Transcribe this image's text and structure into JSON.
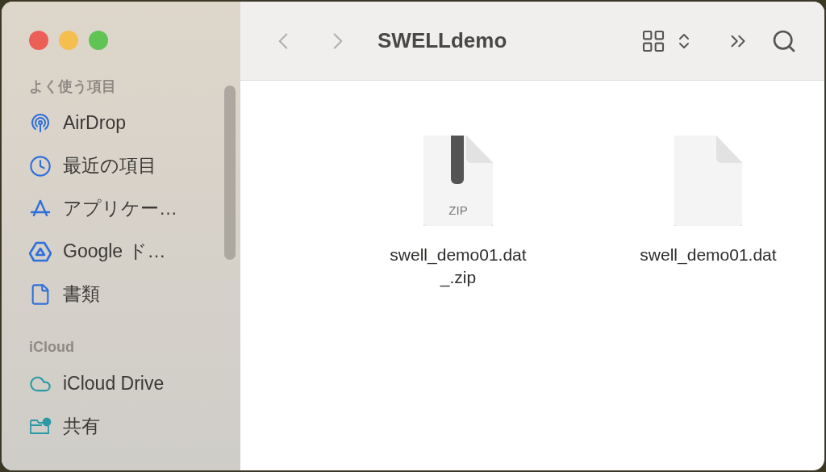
{
  "window": {
    "title": "SWELLdemo"
  },
  "toolbar": {
    "back": {
      "disabled": true
    },
    "forward": {
      "disabled": true
    }
  },
  "sidebar": {
    "sections": [
      {
        "heading": "よく使う項目",
        "items": [
          {
            "kind": "airdrop",
            "label": "AirDrop"
          },
          {
            "kind": "recent",
            "label": "最近の項目"
          },
          {
            "kind": "apps",
            "label": "アプリケー…"
          },
          {
            "kind": "drive",
            "label": "Google ド…"
          },
          {
            "kind": "document",
            "label": "書類"
          }
        ]
      },
      {
        "heading": "iCloud",
        "items": [
          {
            "kind": "cloud",
            "label": "iCloud Drive"
          },
          {
            "kind": "shared",
            "label": "共有"
          }
        ]
      }
    ]
  },
  "files": [
    {
      "kind": "zip",
      "badge": "ZIP",
      "name_lines": [
        "swell_demo01.dat",
        "_.zip"
      ]
    },
    {
      "kind": "document",
      "name_lines": [
        "swell_demo01.dat"
      ]
    }
  ]
}
